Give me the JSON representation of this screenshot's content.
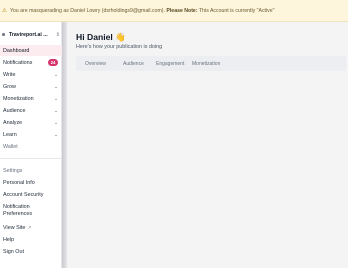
{
  "banner": {
    "icon": "warning-icon",
    "text": "You are masquerading as Daniel Lowry (dsrholdings9@gmail.com).",
    "note_label": "Please Note:",
    "note_text": "This Account is currently \"Active\""
  },
  "sidebar": {
    "publication": "Travireport.ai ...",
    "items": [
      {
        "label": "Dashboard"
      },
      {
        "label": "Notifications",
        "badge": "24"
      },
      {
        "label": "Write"
      },
      {
        "label": "Grow"
      },
      {
        "label": "Monetization"
      },
      {
        "label": "Audience"
      },
      {
        "label": "Analyze"
      },
      {
        "label": "Learn"
      },
      {
        "label": "Wallet"
      }
    ],
    "settings": [
      {
        "label": "Settings"
      },
      {
        "label": "Personal Info"
      },
      {
        "label": "Account Security"
      },
      {
        "label": "Notification Preferences"
      },
      {
        "label": "View Site"
      },
      {
        "label": "Help"
      },
      {
        "label": "Sign Out"
      }
    ]
  },
  "main": {
    "greeting": "Hi Daniel 👋",
    "subtitle": "Here's how your publication is doing",
    "tabs": [
      "Overview",
      "Audience",
      "Engagement",
      "Monetization"
    ]
  },
  "colors": {
    "accent": "#d6336c",
    "banner_bg": "#fdf6dc",
    "active_bg": "#fdecef"
  }
}
